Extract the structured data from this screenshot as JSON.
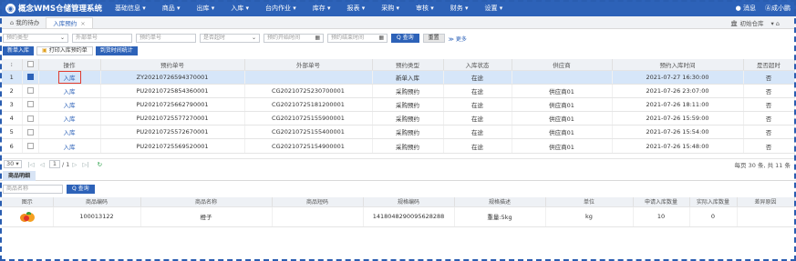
{
  "app": {
    "title": "概念WMS仓储管理系统"
  },
  "menu": [
    "基础信息 ▾",
    "商品 ▾",
    "出库 ▾",
    "入库 ▾",
    "台内作业 ▾",
    "库存 ▾",
    "报表 ▾",
    "采购 ▾",
    "审核 ▾",
    "财务 ▾",
    "设置 ▾"
  ],
  "header": {
    "message": "● 消息",
    "user": "Ⓐ成小鹏"
  },
  "tabs": [
    {
      "label": "我的待办"
    },
    {
      "label": "入库预约",
      "close": "×"
    }
  ],
  "warehouse": {
    "label": "初始仓库",
    "arrow": "▾ ⌂"
  },
  "filters": {
    "type_placeholder": "预约类型",
    "external_no_placeholder": "外部单号",
    "booking_no_placeholder": "预约单号",
    "overdue_placeholder": "是否超时",
    "start_time_placeholder": "预约开始时间",
    "end_time_placeholder": "预约结束时间",
    "query_label": "Q 查询",
    "reset_label": "重置",
    "more_label": "≫ 更多"
  },
  "actions": {
    "create": "新单入库",
    "print": "打印入库预约单",
    "stats": "到货时间统计"
  },
  "table": {
    "columns": [
      "⁝",
      "",
      "操作",
      "预约单号",
      "外部单号",
      "预约类型",
      "入库状态",
      "供应商",
      "预约入库时间",
      "是否超时"
    ],
    "rows": [
      {
        "idx": "1",
        "action": "入库",
        "booking_no": "ZY2021072659437000​1",
        "external_no": "",
        "type": "新单入库",
        "status": "在途",
        "supplier": "",
        "time": "2021-07-27 16:30:00",
        "overdue": "否"
      },
      {
        "idx": "2",
        "action": "入库",
        "booking_no": "PU2021072585436000​1",
        "external_no": "CG2021072523070000​1",
        "type": "采购预约",
        "status": "在途",
        "supplier": "供应商01",
        "time": "2021-07-26 23:07:00",
        "overdue": "否"
      },
      {
        "idx": "3",
        "action": "入库",
        "booking_no": "PU2021072566279000​1",
        "external_no": "CG2021072518120000​1",
        "type": "采购预约",
        "status": "在途",
        "supplier": "供应商01",
        "time": "2021-07-26 18:11:00",
        "overdue": "否"
      },
      {
        "idx": "4",
        "action": "入库",
        "booking_no": "PU2021072557727000​1",
        "external_no": "CG2021072515590000​1",
        "type": "采购预约",
        "status": "在途",
        "supplier": "供应商01",
        "time": "2021-07-26 15:59:00",
        "overdue": "否"
      },
      {
        "idx": "5",
        "action": "入库",
        "booking_no": "PU2021072557267000​1",
        "external_no": "CG2021072515540000​1",
        "type": "采购预约",
        "status": "在途",
        "supplier": "供应商01",
        "time": "2021-07-26 15:54:00",
        "overdue": "否"
      },
      {
        "idx": "6",
        "action": "入库",
        "booking_no": "PU2021072556952000​1",
        "external_no": "CG2021072515490000​1",
        "type": "采购预约",
        "status": "在途",
        "supplier": "供应商01",
        "time": "2021-07-26 15:48:00",
        "overdue": "否"
      }
    ]
  },
  "pager": {
    "page_size": "30 ▾",
    "first": "|◁",
    "prev": "◁",
    "current": "1",
    "of_total": "/ 1",
    "next": "▷",
    "last": "▷|",
    "refresh": "↻",
    "total_text": "每页 30 条, 共 11 条"
  },
  "detail": {
    "tab_label": "商品明细",
    "search_placeholder": "商品名称",
    "query_label": "Q 查询",
    "columns": [
      "图示",
      "商品编码",
      "商品名称",
      "商品短码",
      "规格编码",
      "规格描述",
      "单位",
      "申请入库数量",
      "实际入库数量",
      "差异原因"
    ],
    "rows": [
      {
        "code": "100013122",
        "name": "橙子",
        "short": "",
        "spec_code": "1418048290095628288",
        "spec_desc": "重量:5kg",
        "unit": "kg",
        "apply_qty": "10",
        "actual_qty": "0",
        "reason": ""
      }
    ]
  },
  "colors": {
    "primary": "#2d62b8",
    "highlight": "#e03c31",
    "selected_row": "#d6e6f9"
  }
}
